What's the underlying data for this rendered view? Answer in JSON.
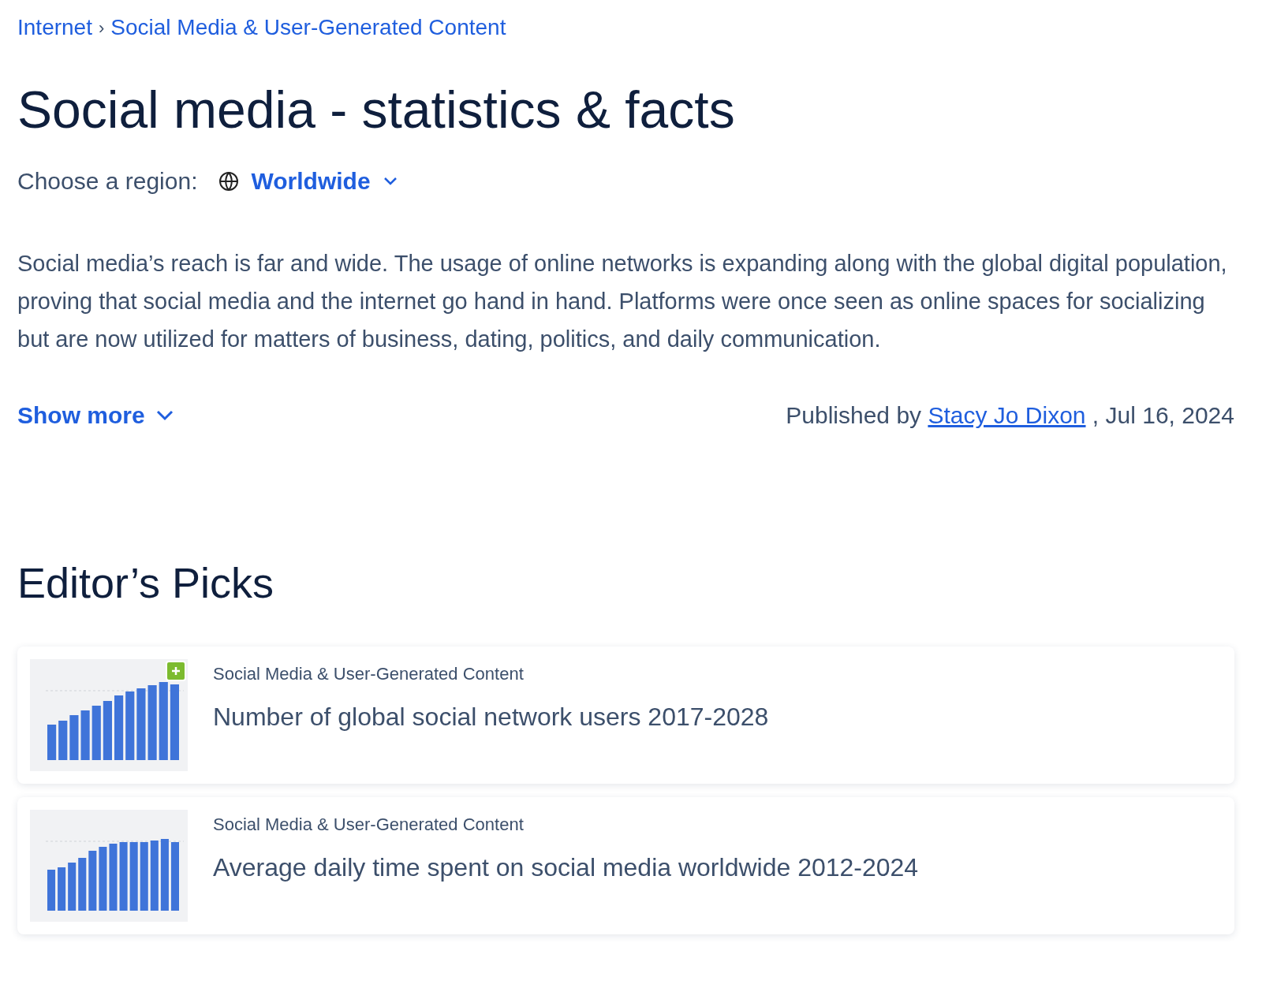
{
  "breadcrumb": [
    {
      "label": "Internet",
      "separator": "›"
    },
    {
      "label": "Social Media & User-Generated Content"
    }
  ],
  "title": "Social media - statistics & facts",
  "region": {
    "label": "Choose a region:",
    "value": "Worldwide"
  },
  "description": "Social media’s reach is far and wide. The usage of online networks is expanding along with the global digital population, proving that social media and the internet go hand in hand. Platforms were once seen as online spaces for socializing but are now utilized for matters of business, dating, politics, and daily communication.",
  "show_more": "Show more",
  "published": {
    "prefix": "Published by",
    "author": "Stacy Jo Dixon",
    "suffix": ", Jul 16, 2024"
  },
  "editors_picks": {
    "heading": "Editor’s Picks",
    "items": [
      {
        "category": "Social Media & User-Generated Content",
        "title": "Number of global social network users 2017-2028",
        "premium": true
      },
      {
        "category": "Social Media & User-Generated Content",
        "title": "Average daily time spent on social media worldwide 2012-2024",
        "premium": false
      }
    ]
  }
}
